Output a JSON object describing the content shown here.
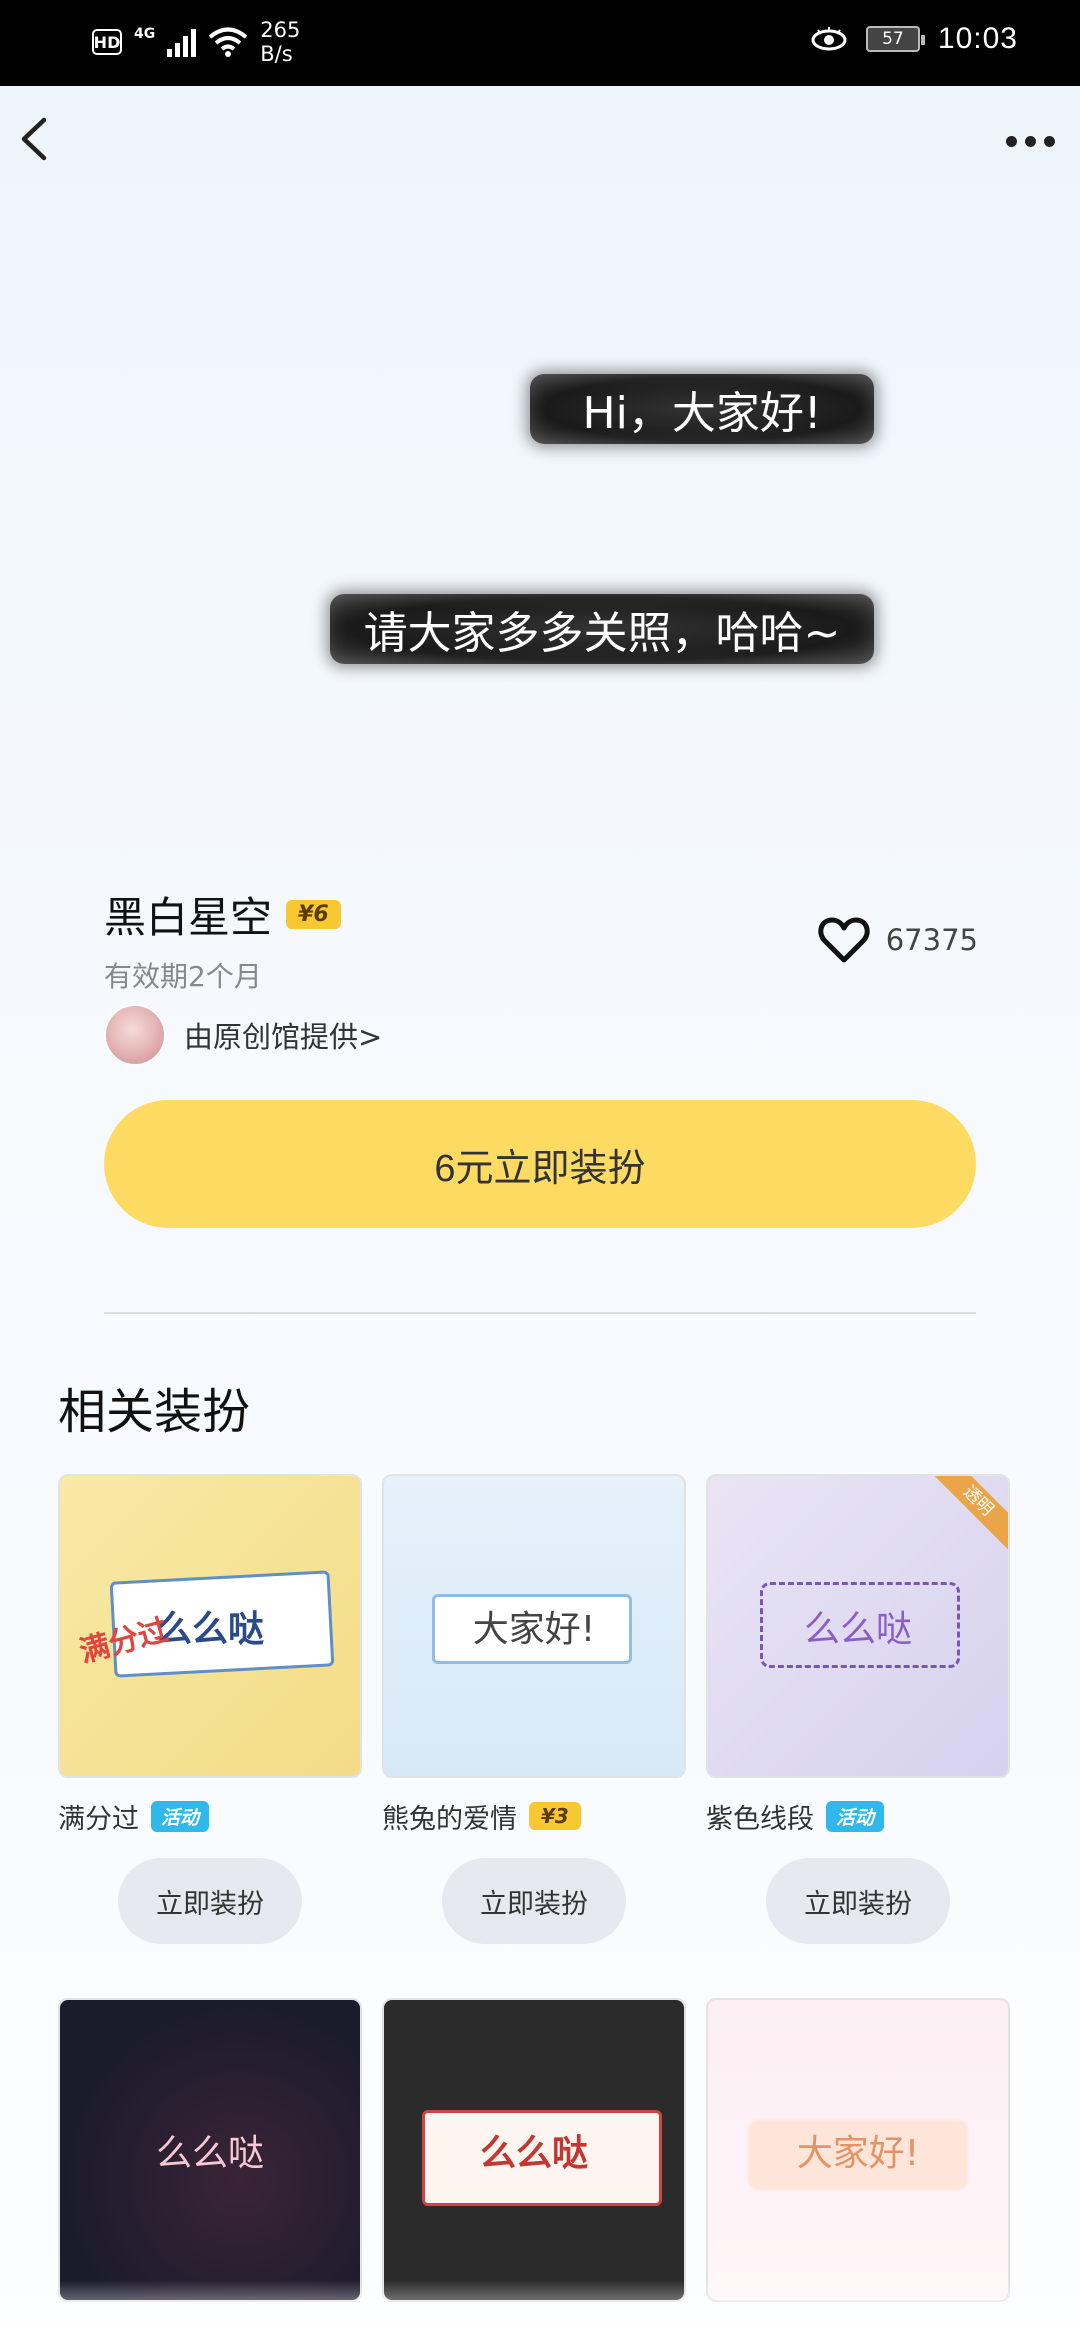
{
  "status_bar": {
    "hd": "HD",
    "network": "4G",
    "speed_value": "265",
    "speed_unit": "B/s",
    "battery": "57",
    "time": "10:03"
  },
  "nav": {
    "back_icon": "chevron-left-icon",
    "more_icon": "more-dots-icon"
  },
  "preview": {
    "bubble_1": "Hi，大家好!",
    "bubble_2": "请大家多多关照，哈哈~"
  },
  "item": {
    "name": "黑白星空",
    "price_badge": "¥6",
    "validity": "有效期2个月",
    "provider": "由原创馆提供>",
    "likes": "67375",
    "cta_label": "6元立即装扮"
  },
  "related": {
    "title": "相关装扮",
    "apply_label": "立即装扮",
    "cards": [
      {
        "name": "满分过",
        "badge": "活动",
        "badge_type": "event",
        "preview_text": "么么哒",
        "stamp": "满分过"
      },
      {
        "name": "熊兔的爱情",
        "badge": "¥3",
        "badge_type": "price",
        "preview_text": "大家好!"
      },
      {
        "name": "紫色线段",
        "badge": "活动",
        "badge_type": "event",
        "preview_text": "么么哒",
        "corner": "透明"
      },
      {
        "preview_text": "么么哒"
      },
      {
        "preview_text": "么么哒"
      },
      {
        "preview_text": "大家好!"
      }
    ]
  },
  "colors": {
    "cta": "#fddb63",
    "price_badge": "#f8c832",
    "event_badge": "#2fb9ea"
  }
}
